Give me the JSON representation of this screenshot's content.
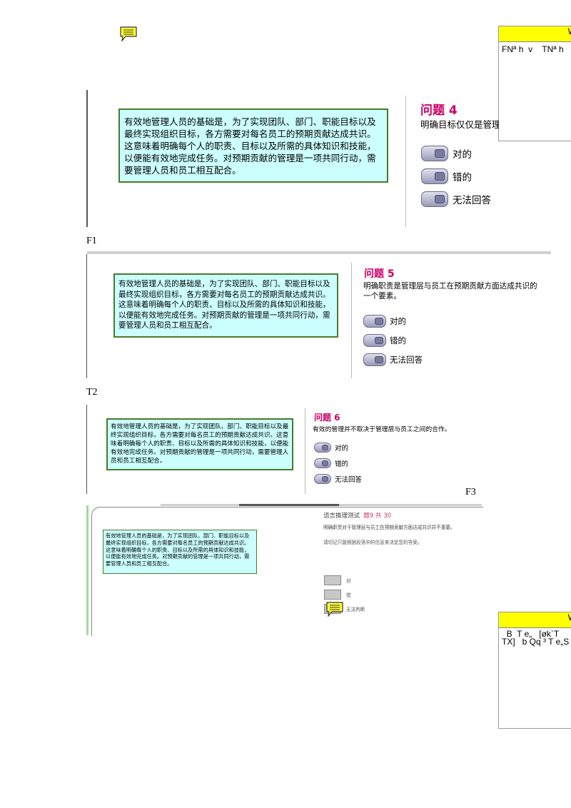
{
  "comments": {
    "top": {
      "header": "W",
      "body": "FNª h  v    TNª h"
    },
    "bottom": {
      "header": "W",
      "body": "  B  T e„   [øk`T\nTX]   b Qq ³ T e„S"
    }
  },
  "labels": {
    "f1": "F1",
    "t2": "T2",
    "f3": "F3"
  },
  "passage": "有效地管理人员的基础是，为了实现团队、部门、职能目标以及最终实现组织目标，各方需要对每名员工的预期贡献达成共识。这意味着明确每个人的职责、目标以及所需的具体知识和技能，以便能有效地完成任务。对预期贡献的管理是一项共同行动，需要管理人员和员工相互配合。",
  "q4": {
    "title": "问题 4",
    "text": "明确目标仅仅是管理",
    "options": [
      "对的",
      "错的",
      "无法回答"
    ]
  },
  "q5": {
    "title": "问题 5",
    "text": "明确职责是管理层与员工在预期贡献方面达成共识的一个要素。",
    "options": [
      "对的",
      "错的",
      "无法回答"
    ]
  },
  "q6": {
    "title": "问题 6",
    "text": "有效的管理并不取决于管理层与员工之间的合作。",
    "options": [
      "对的",
      "错的",
      "无法回答"
    ]
  },
  "q9": {
    "test_name": "语言推理测试",
    "progress": "题9 共 30",
    "text": "明确职责对于管理层与员工在预期贡献方面达成共识并不重要。",
    "instruction": "请切记只能根据段落中的信息来决定您的答案。",
    "options": [
      "对",
      "错",
      "无法判断"
    ]
  }
}
